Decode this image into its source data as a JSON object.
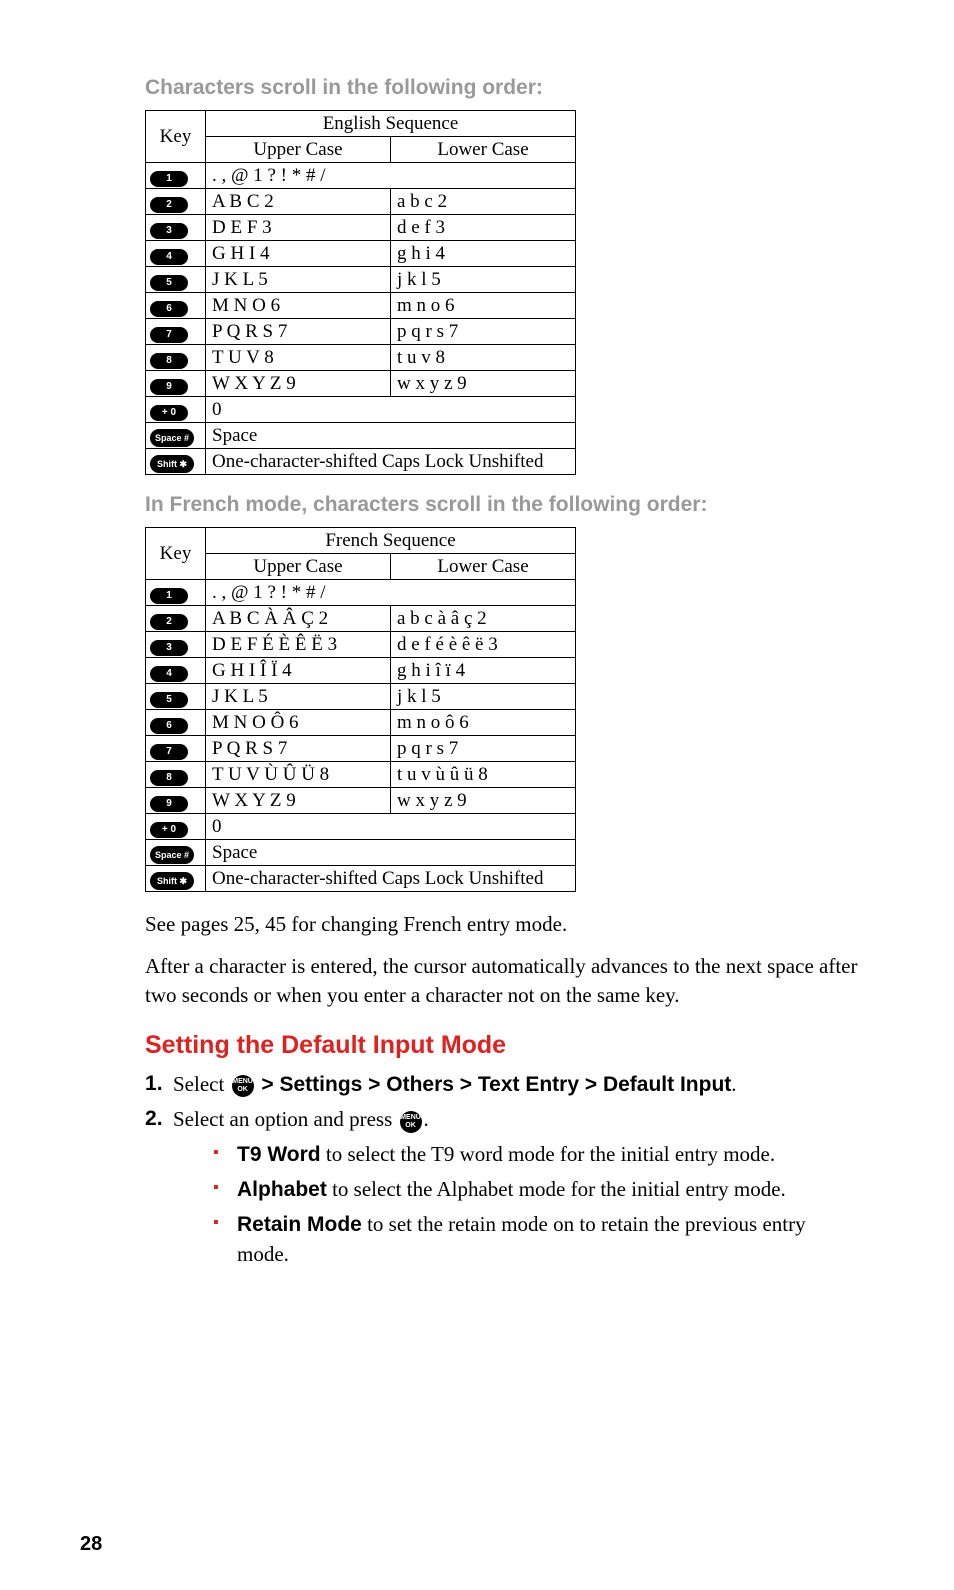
{
  "headings": {
    "english_order": "Characters scroll in the following order:",
    "french_order": "In French mode, characters scroll in the following order:",
    "section_red": "Setting the Default Input Mode"
  },
  "table_labels": {
    "key": "Key",
    "eng_seq": "English Sequence",
    "fr_seq": "French Sequence",
    "upper": "Upper Case",
    "lower": "Lower Case"
  },
  "english_table": {
    "rows": [
      {
        "key": "1",
        "upper": ". , @ 1 ? ! * # /",
        "span": true
      },
      {
        "key": "2",
        "upper": "A B C 2",
        "lower": "a b c 2"
      },
      {
        "key": "3",
        "upper": "D E F 3",
        "lower": "d e f 3"
      },
      {
        "key": "4",
        "upper": "G H I 4",
        "lower": "g h i 4"
      },
      {
        "key": "5",
        "upper": "J K L 5",
        "lower": "j k l 5"
      },
      {
        "key": "6",
        "upper": "M N O 6",
        "lower": "m n o 6"
      },
      {
        "key": "7",
        "upper": "P Q R S 7",
        "lower": "p q r s 7"
      },
      {
        "key": "8",
        "upper": "T U V 8",
        "lower": "t u v 8"
      },
      {
        "key": "9",
        "upper": "W X Y Z 9",
        "lower": "w x y z 9"
      },
      {
        "key": "+ 0",
        "upper": "0",
        "span": true
      },
      {
        "key": "Space #",
        "wide": true,
        "upper": "Space",
        "span": true
      },
      {
        "key": "Shift ✱",
        "wide": true,
        "upper": "One-character-shifted  Caps Lock  Unshifted",
        "span": true
      }
    ]
  },
  "french_table": {
    "rows": [
      {
        "key": "1",
        "upper": ". , @ 1 ? ! * # /",
        "span": true
      },
      {
        "key": "2",
        "upper": "A B C À Â Ç 2",
        "lower": "a b c à â ç 2"
      },
      {
        "key": "3",
        "upper": "D E F É È Ê Ë 3",
        "lower": "d e f é è ê ë 3"
      },
      {
        "key": "4",
        "upper": "G H I Î Ï 4",
        "lower": "g h i î ï 4"
      },
      {
        "key": "5",
        "upper": "J K L 5",
        "lower": "j k l 5"
      },
      {
        "key": "6",
        "upper": "M N O Ô 6",
        "lower": "m n o ô 6"
      },
      {
        "key": "7",
        "upper": "P Q R S 7",
        "lower": "p q r s 7"
      },
      {
        "key": "8",
        "upper": "T U V Ù Û Ü 8",
        "lower": "t u v ù û ü 8"
      },
      {
        "key": "9",
        "upper": "W X Y Z 9",
        "lower": "w x y z 9"
      },
      {
        "key": "+ 0",
        "upper": "0",
        "span": true
      },
      {
        "key": "Space #",
        "wide": true,
        "upper": "Space",
        "span": true
      },
      {
        "key": "Shift ✱",
        "wide": true,
        "upper": "One-character-shifted  Caps Lock  Unshifted",
        "span": true
      }
    ]
  },
  "body": {
    "see_pages": "See pages 25, 45 for changing French entry mode.",
    "after_char": "After a character is entered, the cursor automatically advances to the next space after two seconds or when you enter a character not on the same key."
  },
  "steps": {
    "step1_prefix": "Select ",
    "step1_path": " > Settings > Others > Text Entry > Default Input",
    "step1_period": ".",
    "step2_prefix": "Select an option and press ",
    "step2_period": "."
  },
  "bullets": {
    "b1_bold": "T9 Word",
    "b1_rest": " to select the T9 word mode for the initial entry mode.",
    "b2_bold": "Alphabet",
    "b2_rest": " to select the Alphabet mode for the initial entry mode.",
    "b3_bold": "Retain Mode",
    "b3_rest": " to set the retain mode on to retain the previous entry mode."
  },
  "menu_ok": {
    "line1": "MENU",
    "line2": "OK"
  },
  "page_number": "28"
}
